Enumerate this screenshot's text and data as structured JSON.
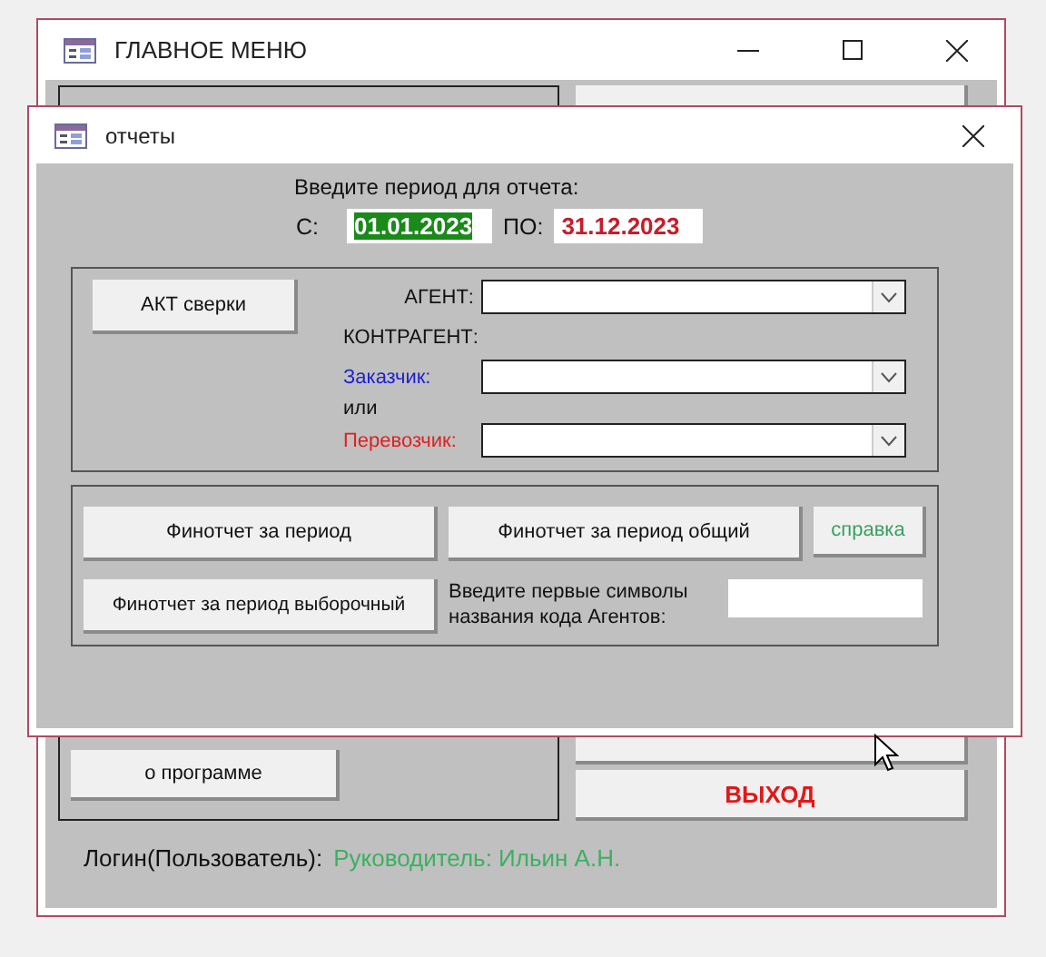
{
  "main_window": {
    "title": "ГЛАВНОЕ МЕНЮ",
    "about_button": "о программе",
    "exit_button": "ВЫХОД",
    "login_label": "Логин(Пользователь):",
    "login_value": "Руководитель: Ильин А.Н."
  },
  "dialog": {
    "title": "отчеты",
    "prompt": "Введите период для отчета:",
    "date_from": {
      "label": "С:",
      "value": "01.01.2023",
      "focused": true
    },
    "date_to": {
      "label": "ПО:",
      "value": "31.12.2023",
      "focused": false
    },
    "act_button": "АКТ сверки",
    "agent_label": "АГЕНТ:",
    "counterparty_label": "КОНТРАГЕНТ:",
    "customer_label": "Заказчик:",
    "or_label": "или",
    "carrier_label": "Перевозчик:",
    "report_buttons": [
      "Финотчет за период",
      "Финотчет за период общий"
    ],
    "help_button": "справка",
    "selective_button": "Финотчет за период выборочный",
    "agent_code_label": "Введите первые символы названия кода Агентов:"
  }
}
